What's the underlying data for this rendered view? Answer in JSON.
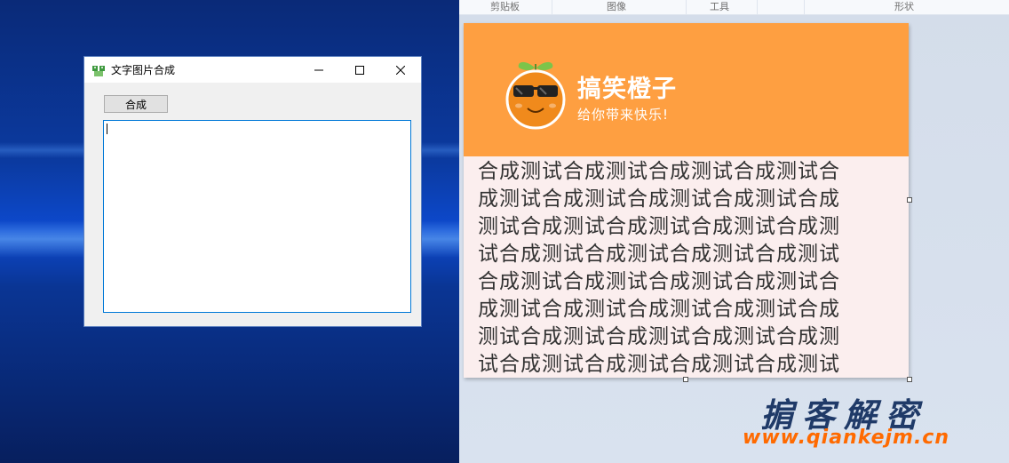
{
  "ribbon": {
    "groups": [
      "剪贴板",
      "图像",
      "工具",
      "形状"
    ]
  },
  "window": {
    "title": "文字图片合成",
    "compose_button": "合成",
    "textarea_value": ""
  },
  "image": {
    "brand_title": "搞笑橙子",
    "brand_subtitle": "给你带来快乐!",
    "lines": [
      "合成测试合成测试合成测试合成测试合",
      "成测试合成测试合成测试合成测试合成",
      "测试合成测试合成测试合成测试合成测",
      "试合成测试合成测试合成测试合成测试",
      "合成测试合成测试合成测试合成测试合",
      "成测试合成测试合成测试合成测试合成",
      "测试合成测试合成测试合成测试合成测",
      "试合成测试合成测试合成测试合成测试"
    ],
    "colors": {
      "banner": "#fe9f41",
      "text_background": "#fbeeee"
    }
  },
  "watermark": {
    "title": "掮客解密",
    "url": "www.qiankejm.cn"
  }
}
